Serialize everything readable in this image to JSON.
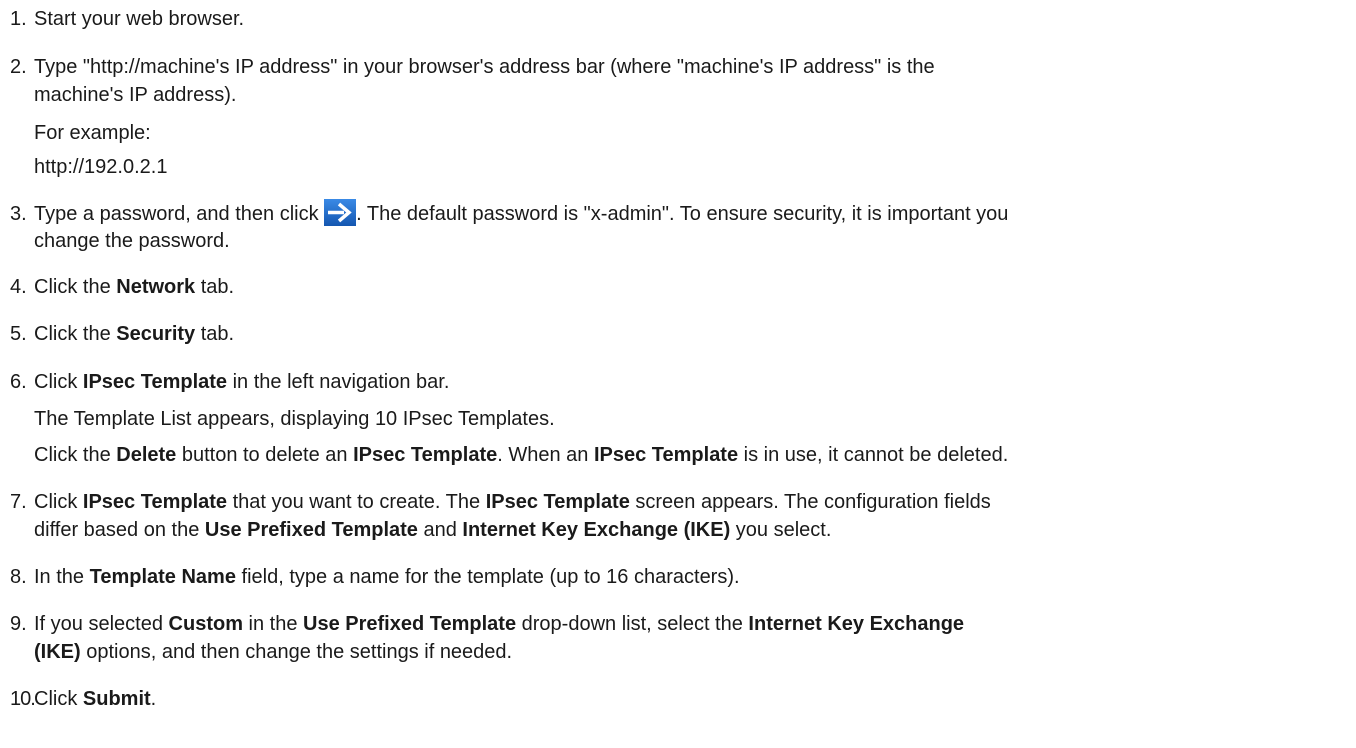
{
  "steps": [
    {
      "n": "1.",
      "text": "Start your web browser."
    },
    {
      "n": "2.",
      "line1": "Type \"http://machine's IP address\" in your browser's address bar (where \"machine's IP address\" is the",
      "line2": "machine's IP address).",
      "example_label": "For example:",
      "example_value": "http://192.0.2.1"
    },
    {
      "n": "3.",
      "before_icon": "Type a password, and then click ",
      "after_icon": ". The default password is \"x-admin\". To ensure security, it is important you",
      "line2": "change the password."
    },
    {
      "n": "4.",
      "t1": "Click the ",
      "b1": "Network",
      "t2": " tab."
    },
    {
      "n": "5.",
      "t1": "Click the ",
      "b1": "Security",
      "t2": " tab."
    },
    {
      "n": "6.",
      "t1": "Click ",
      "b1": "IPsec Template",
      "t2": " in the left navigation bar.",
      "sub1": "The Template List appears, displaying 10 IPsec Templates.",
      "s2a": "Click the ",
      "s2b": "Delete",
      "s2c": " button to delete an ",
      "s2d": "IPsec Template",
      "s2e": ". When an ",
      "s2f": "IPsec Template",
      "s2g": " is in use, it cannot be deleted."
    },
    {
      "n": "7.",
      "t1": "Click ",
      "b1": "IPsec Template",
      "t2": " that you want to create. The ",
      "b2": "IPsec Template",
      "t3": " screen appears. The configuration fields",
      "l2a": "differ based on the ",
      "l2b": "Use Prefixed Template",
      "l2c": " and ",
      "l2d": "Internet Key Exchange (IKE)",
      "l2e": " you select."
    },
    {
      "n": "8.",
      "t1": "In the ",
      "b1": "Template Name",
      "t2": " field, type a name for the template (up to 16 characters)."
    },
    {
      "n": "9.",
      "t1": "If you selected ",
      "b1": "Custom",
      "t2": " in the ",
      "b2": "Use Prefixed Template",
      "t3": " drop-down list, select the ",
      "b3": "Internet Key Exchange",
      "l2a": "(IKE)",
      "l2b": " options, and then change the settings if needed."
    },
    {
      "n": "10.",
      "t1": "Click ",
      "b1": "Submit",
      "t2": "."
    }
  ],
  "icon": {
    "name": "arrow-right-icon",
    "bg": "#1a63c4",
    "fg": "#ffffff"
  }
}
